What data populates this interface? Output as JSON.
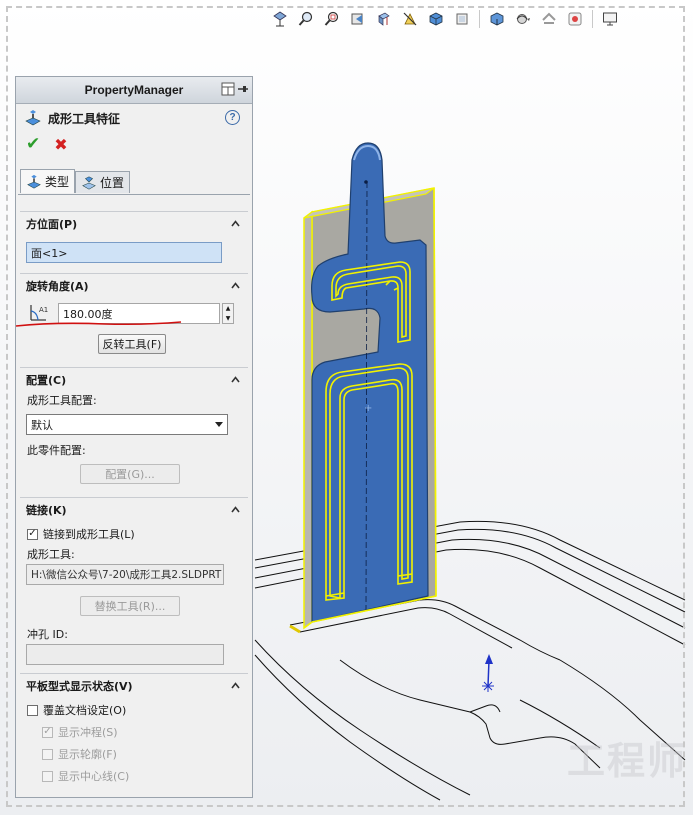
{
  "property_manager": {
    "header": "PropertyManager",
    "feature_title": "成形工具特征",
    "help": "?",
    "ok": "✔",
    "cancel": "✖",
    "tabs": [
      {
        "label": "类型",
        "active": true
      },
      {
        "label": "位置",
        "active": false
      }
    ],
    "face_group": {
      "title": "方位面(P)",
      "value": "面<1>"
    },
    "rotation_group": {
      "title": "旋转角度(A)",
      "angle_value": "180.00度",
      "reverse_button": "反转工具(F)"
    },
    "config_group": {
      "title": "配置(C)",
      "tool_config_label": "成形工具配置:",
      "tool_config_value": "默认",
      "part_config_label": "此零件配置:",
      "config_button": "配置(G)..."
    },
    "link_group": {
      "title": "链接(K)",
      "link_checkbox": "链接到成形工具(L)",
      "link_checked": true,
      "tool_label": "成形工具:",
      "tool_path": "H:\\微信公众号\\7-20\\成形工具2.SLDPRT",
      "replace_button": "替换工具(R)...",
      "punch_label": "冲孔 ID:",
      "punch_value": ""
    },
    "flat_group": {
      "title": "平板型式显示状态(V)",
      "override": {
        "label": "覆盖文档设定(O)",
        "checked": false
      },
      "show_punch": {
        "label": "显示冲程(S)",
        "checked": true
      },
      "show_profile": {
        "label": "显示轮廓(F)",
        "checked": false
      },
      "show_centerline": {
        "label": "显示中心线(C)",
        "checked": false
      }
    }
  },
  "toolbar_icons": [
    "view-orientation-icon",
    "zoom-to-fit-icon",
    "zoom-area-icon",
    "previous-view-icon",
    "section-view-icon",
    "dynamic-annotation-icon",
    "display-style-icon",
    "hide-show-icon",
    "edit-appearance-icon",
    "apply-scene-icon",
    "view-settings-icon"
  ],
  "watermark": "工程师",
  "colors": {
    "tool_blue": "#3a6bb5",
    "tool_dark": "#2c4f87",
    "highlight_yellow": "#f2f200",
    "backplate": "#a9a8a2",
    "annotation_red": "#d01010"
  }
}
